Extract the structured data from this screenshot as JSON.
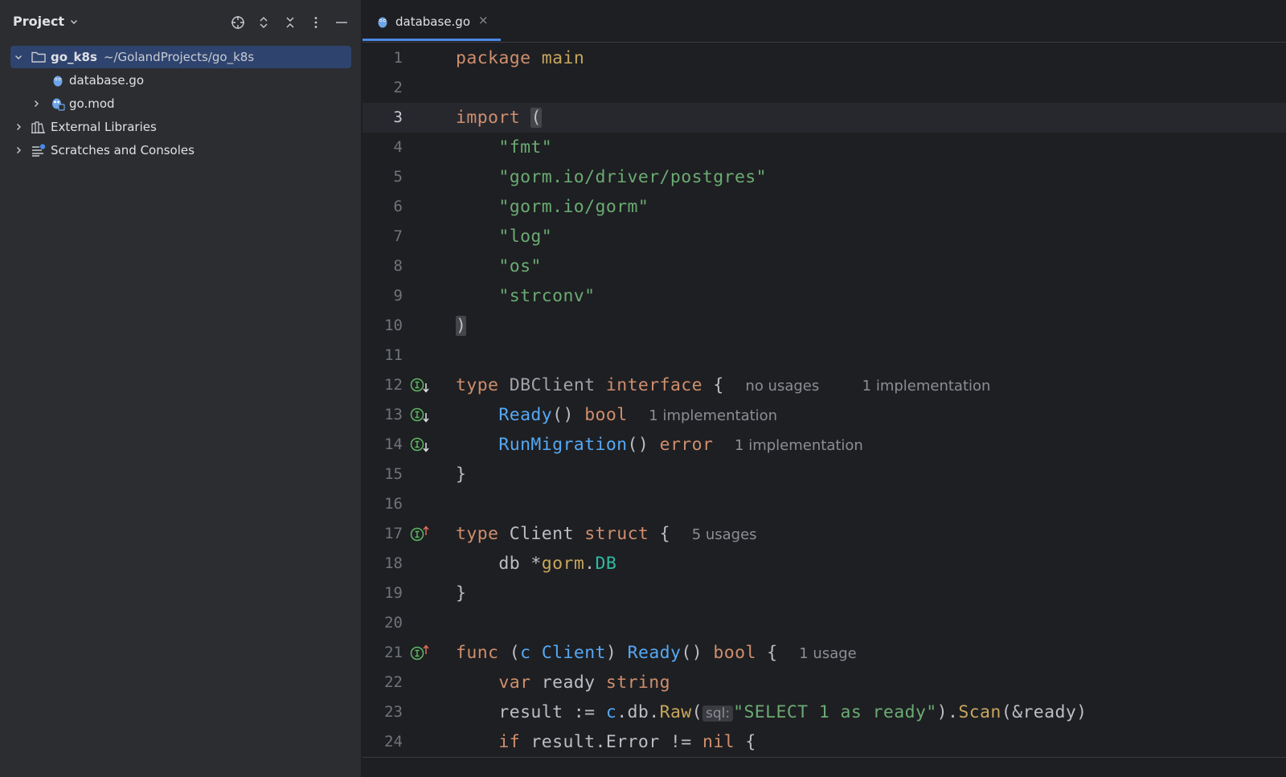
{
  "project_panel": {
    "title": "Project",
    "tree": {
      "root_name": "go_k8s",
      "root_path": "~/GolandProjects/go_k8s",
      "file1": "database.go",
      "file2": "go.mod",
      "external": "External Libraries",
      "scratches": "Scratches and Consoles"
    }
  },
  "editor": {
    "tab_label": "database.go",
    "tab_close": "×",
    "line_numbers": [
      "1",
      "2",
      "3",
      "4",
      "5",
      "6",
      "7",
      "8",
      "9",
      "10",
      "11",
      "12",
      "13",
      "14",
      "15",
      "16",
      "17",
      "18",
      "19",
      "20",
      "21",
      "22",
      "23",
      "24"
    ],
    "code": {
      "l1_kw": "package",
      "l1_name": "main",
      "l3_kw": "import",
      "l3_paren": "(",
      "l4": "\"fmt\"",
      "l5": "\"gorm.io/driver/postgres\"",
      "l6": "\"gorm.io/gorm\"",
      "l7": "\"log\"",
      "l8": "\"os\"",
      "l9": "\"strconv\"",
      "l10": ")",
      "l12_type": "type",
      "l12_name": "DBClient",
      "l12_iface": "interface",
      "l12_brace": "{",
      "l12_hint1": "no usages",
      "l12_hint2": "1 implementation",
      "l13_fn": "Ready",
      "l13_parens": "()",
      "l13_ret": "bool",
      "l13_hint": "1 implementation",
      "l14_fn": "RunMigration",
      "l14_parens": "()",
      "l14_ret": "error",
      "l14_hint": "1 implementation",
      "l15": "}",
      "l17_type": "type",
      "l17_name": "Client",
      "l17_struct": "struct",
      "l17_brace": "{",
      "l17_hint": "5 usages",
      "l18_field": "db *",
      "l18_pkg": "gorm",
      "l18_dot": ".",
      "l18_type": "DB",
      "l19": "}",
      "l21_func": "func",
      "l21_open": "(",
      "l21_recv": "c",
      "l21_rtype": "Client",
      "l21_close": ")",
      "l21_fn": "Ready",
      "l21_parens": "()",
      "l21_ret": "bool",
      "l21_brace": "{",
      "l21_hint": "1 usage",
      "l22_var": "var",
      "l22_name": "ready",
      "l22_type": "string",
      "l23_a": "result := ",
      "l23_c": "c",
      "l23_b": ".db.",
      "l23_raw": "Raw",
      "l23_open": "(",
      "l23_inlay": "sql:",
      "l23_str": "\"SELECT 1 as ready\"",
      "l23_c2": ").",
      "l23_scan": "Scan",
      "l23_rest": "(&ready)",
      "l24_if": "if",
      "l24_mid": "result.Error != ",
      "l24_nil": "nil",
      "l24_brace": "{"
    }
  },
  "colors": {
    "panel_bg": "#2b2d30",
    "editor_bg": "#1e1f22",
    "selection": "#2e436e",
    "accent": "#4a88e6",
    "keyword": "#cf8e6d",
    "string": "#6aab73",
    "function": "#56a8f5"
  }
}
